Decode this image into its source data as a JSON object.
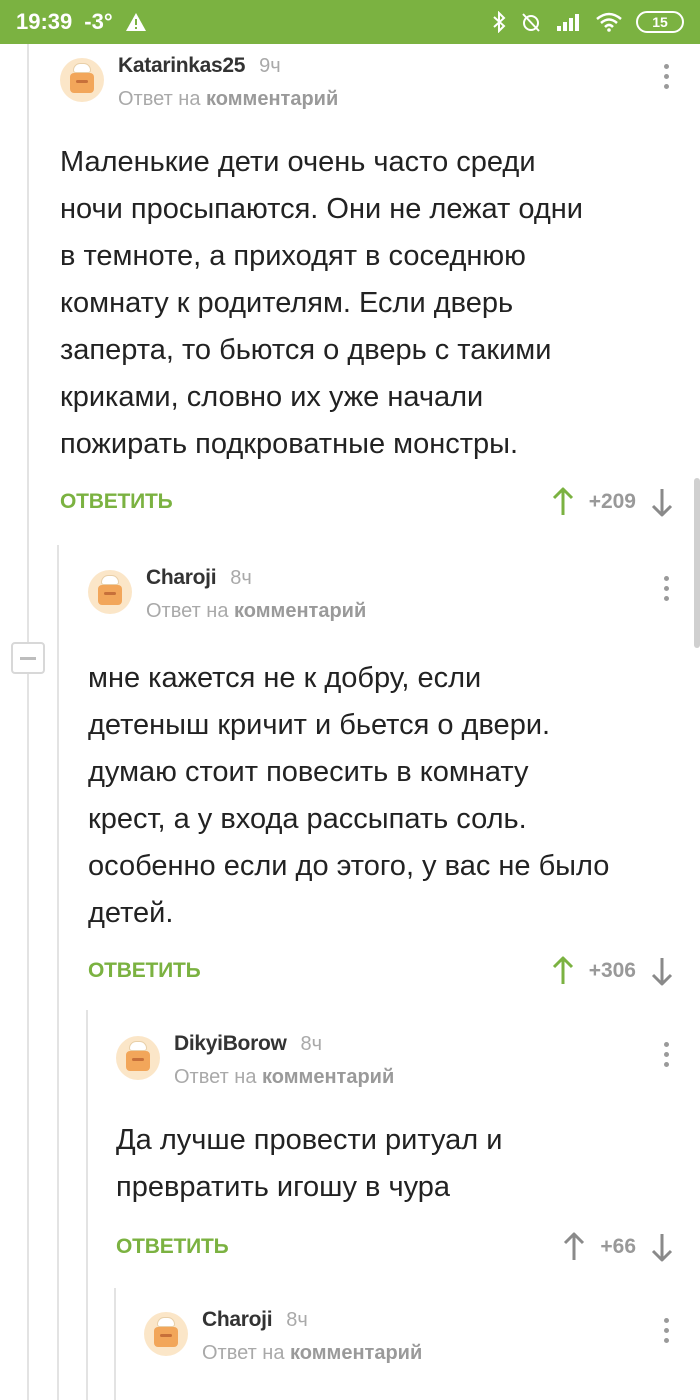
{
  "status_bar": {
    "time": "19:39",
    "temperature": "-3°",
    "battery": "15"
  },
  "comments": [
    {
      "author": "Katarinkas25",
      "time": "9ч",
      "reply_prefix": "Ответ на",
      "reply_target": "комментарий",
      "text_lines": [
        "Маленькие дети очень часто среди",
        "ночи просыпаются. Они не лежат одни",
        "в темноте, а приходят в соседнюю",
        "комнату к родителям. Если дверь",
        "заперта, то бьются о дверь с такими",
        "криками, словно их уже начали",
        "пожирать подкроватные монстры."
      ],
      "reply_label": "ОТВЕТИТЬ",
      "rating": "+209",
      "upvoted": true
    },
    {
      "author": "Charoji",
      "time": "8ч",
      "reply_prefix": "Ответ на",
      "reply_target": "комментарий",
      "text_lines": [
        "мне кажется не к добру, если",
        "детеныш кричит и бьется о двери.",
        "думаю стоит повесить в комнату",
        "крест, а у входа рассыпать соль.",
        "особенно если до этого, у вас не было",
        "детей."
      ],
      "reply_label": "ОТВЕТИТЬ",
      "rating": "+306",
      "upvoted": true
    },
    {
      "author": "DikyiBorow",
      "time": "8ч",
      "reply_prefix": "Ответ на",
      "reply_target": "комментарий",
      "text_lines": [
        "Да лучше провести ритуал и",
        "превратить игошу в чура"
      ],
      "reply_label": "ОТВЕТИТЬ",
      "rating": "+66",
      "upvoted": false
    },
    {
      "author": "Charoji",
      "time": "8ч",
      "reply_prefix": "Ответ на",
      "reply_target": "комментарий",
      "text_lines": [],
      "reply_label": "",
      "rating": "",
      "upvoted": false
    }
  ],
  "colors": {
    "accent": "#7bb241",
    "muted": "#a9a9a9"
  }
}
